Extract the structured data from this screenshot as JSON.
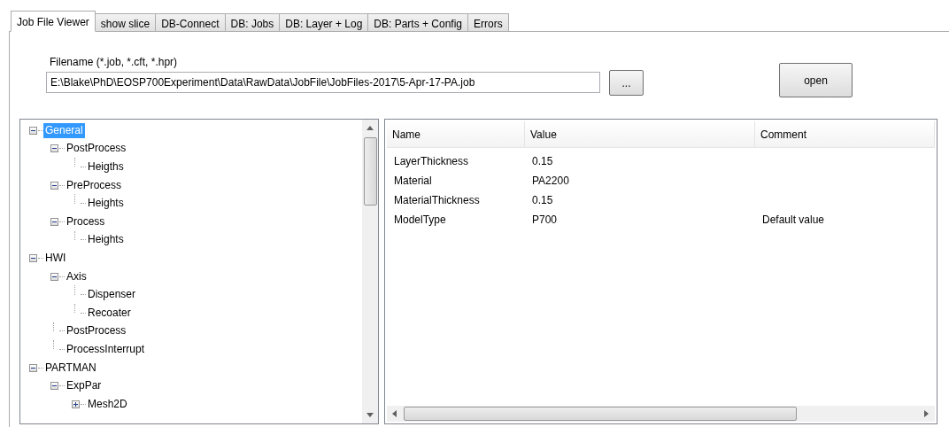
{
  "tabs": [
    {
      "label": "Job File Viewer",
      "selected": true
    },
    {
      "label": "show slice",
      "selected": false
    },
    {
      "label": "DB-Connect",
      "selected": false
    },
    {
      "label": "DB: Jobs",
      "selected": false
    },
    {
      "label": "DB: Layer + Log",
      "selected": false
    },
    {
      "label": "DB: Parts + Config",
      "selected": false
    },
    {
      "label": "Errors",
      "selected": false
    }
  ],
  "filename": {
    "label": "Filename (*.job, *.cft, *.hpr)",
    "value": "E:\\Blake\\PhD\\EOSP700Experiment\\Data\\RawData\\JobFile\\JobFiles-2017\\5-Apr-17-PA.job",
    "browse_button": "...",
    "open_button": "open"
  },
  "tree": [
    {
      "label": "General",
      "selected": true,
      "expanded": true,
      "children": [
        {
          "label": "PostProcess",
          "selected": false,
          "expanded": true,
          "children": [
            {
              "label": "Heigths",
              "selected": false
            }
          ]
        },
        {
          "label": "PreProcess",
          "selected": false,
          "expanded": true,
          "children": [
            {
              "label": "Heights",
              "selected": false
            }
          ]
        },
        {
          "label": "Process",
          "selected": false,
          "expanded": true,
          "children": [
            {
              "label": "Heights",
              "selected": false
            }
          ]
        }
      ]
    },
    {
      "label": "HWI",
      "selected": false,
      "expanded": true,
      "children": [
        {
          "label": "Axis",
          "selected": false,
          "expanded": true,
          "children": [
            {
              "label": "Dispenser",
              "selected": false
            },
            {
              "label": "Recoater",
              "selected": false
            }
          ]
        },
        {
          "label": "PostProcess",
          "selected": false
        },
        {
          "label": "ProcessInterrupt",
          "selected": false
        }
      ]
    },
    {
      "label": "PARTMAN",
      "selected": false,
      "expanded": true,
      "children": [
        {
          "label": "ExpPar",
          "selected": false,
          "expanded": true,
          "children": [
            {
              "label": "Mesh2D",
              "selected": false,
              "expanded": false
            }
          ]
        }
      ]
    }
  ],
  "table": {
    "columns": [
      "Name",
      "Value",
      "Comment"
    ],
    "rows": [
      [
        "LayerThickness",
        "0.15",
        ""
      ],
      [
        "Material",
        "PA2200",
        ""
      ],
      [
        "MaterialThickness",
        "0.15",
        ""
      ],
      [
        "ModelType",
        "P700",
        "Default value"
      ]
    ]
  }
}
